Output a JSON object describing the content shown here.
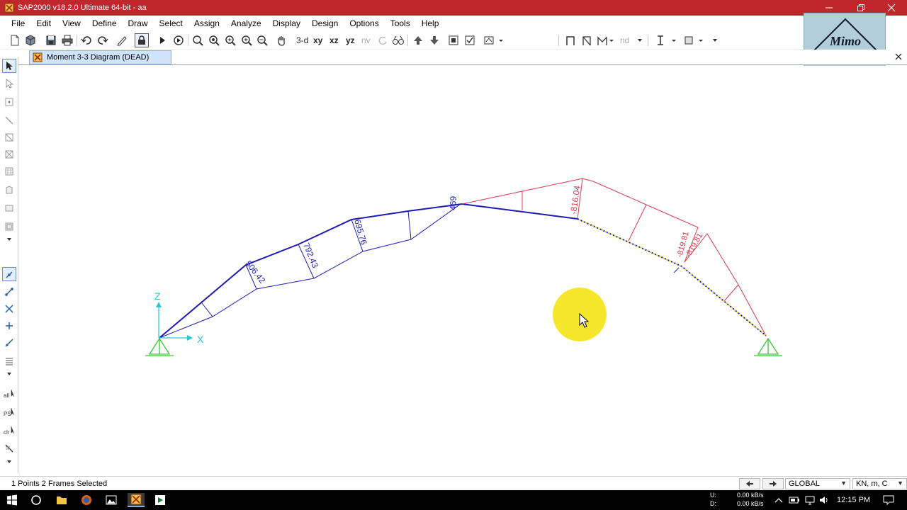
{
  "window": {
    "title": "SAP2000 v18.2.0 Ultimate 64-bit - aa"
  },
  "menu": [
    "File",
    "Edit",
    "View",
    "Define",
    "Draw",
    "Select",
    "Assign",
    "Analyze",
    "Display",
    "Design",
    "Options",
    "Tools",
    "Help"
  ],
  "toolbar": {
    "view_3d": "3-d",
    "view_xy": "xy",
    "view_xz": "xz",
    "view_yz": "yz",
    "view_nv": "nv",
    "nd": "nd"
  },
  "logo": {
    "text": "Mimo"
  },
  "tab": {
    "label": "Moment 3-3 Diagram (DEAD)"
  },
  "diagram": {
    "axis_z": "Z",
    "axis_x": "X",
    "labels": [
      "506.42",
      "792.43",
      "695.76",
      "469",
      "-816.04",
      "-819.81",
      "-819.81"
    ]
  },
  "status": {
    "selection": "1 Points  2 Frames Selected",
    "coord_system": "GLOBAL",
    "units": "KN, m, C"
  },
  "taskbar": {
    "net_up_label": "U:",
    "net_down_label": "D:",
    "net_up": "0.00 kB/s",
    "net_down": "0.00 kB/s",
    "time": "12:15 PM"
  },
  "colors": {
    "titlebar": "#c0272d",
    "positive_moment": "#1c1cb4",
    "negative_moment": "#d83a4c",
    "support": "#39c739",
    "axes": "#27c7d8",
    "cursor_highlight": "#f5e51a"
  }
}
